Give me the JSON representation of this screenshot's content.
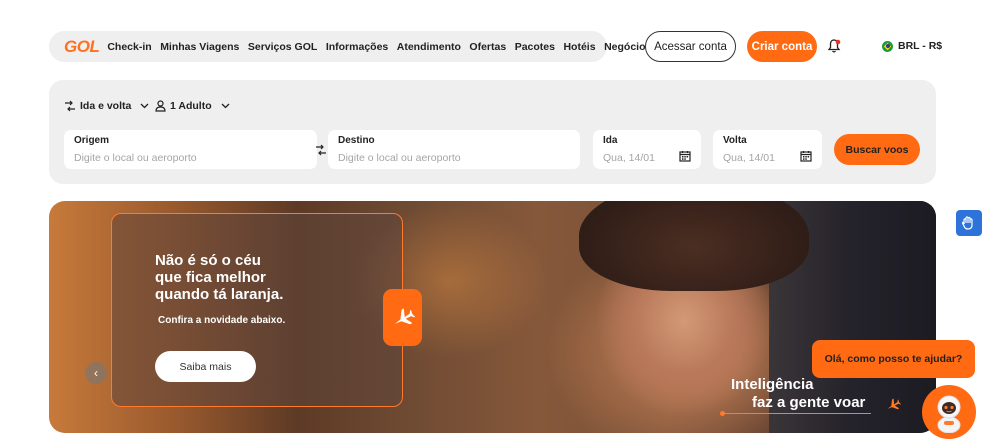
{
  "header": {
    "logo": "GOL",
    "nav_items": [
      "Check-in",
      "Minhas Viagens",
      "Serviços GOL",
      "Informações",
      "Atendimento",
      "Ofertas",
      "Pacotes",
      "Hotéis",
      "Negócios"
    ],
    "login_label": "Acessar conta",
    "signup_label": "Criar conta",
    "currency": "BRL - R$"
  },
  "search": {
    "trip_type": "Ida e volta",
    "passengers": "1 Adulto",
    "origin": {
      "label": "Origem",
      "placeholder": "Digite o local ou aeroporto"
    },
    "destination": {
      "label": "Destino",
      "placeholder": "Digite o local ou aeroporto"
    },
    "depart": {
      "label": "Ida",
      "placeholder": "Qua, 14/01"
    },
    "return": {
      "label": "Volta",
      "placeholder": "Qua, 14/01"
    },
    "submit_label": "Buscar voos"
  },
  "hero": {
    "title_lines": [
      "Não é só o céu",
      "que fica melhor",
      "quando tá laranja."
    ],
    "subtitle": "Confira a novidade abaixo.",
    "cta_label": "Saiba mais",
    "prev_glyph": "‹",
    "tagline_lines": [
      "Inteligência",
      "faz a gente voar"
    ]
  },
  "chat": {
    "greeting": "Olá, como posso te ajudar?"
  },
  "colors": {
    "brand_orange": "#ff6a13",
    "panel_gray": "#efefef",
    "a11y_blue": "#2d73d9"
  },
  "icons": [
    "bell-icon",
    "brazil-flag-icon",
    "trip-type-icon",
    "person-icon",
    "chevron-down-icon",
    "swap-icon",
    "calendar-icon",
    "plane-icon",
    "chevron-left-icon",
    "sign-language-icon",
    "chatbot-avatar-icon"
  ]
}
